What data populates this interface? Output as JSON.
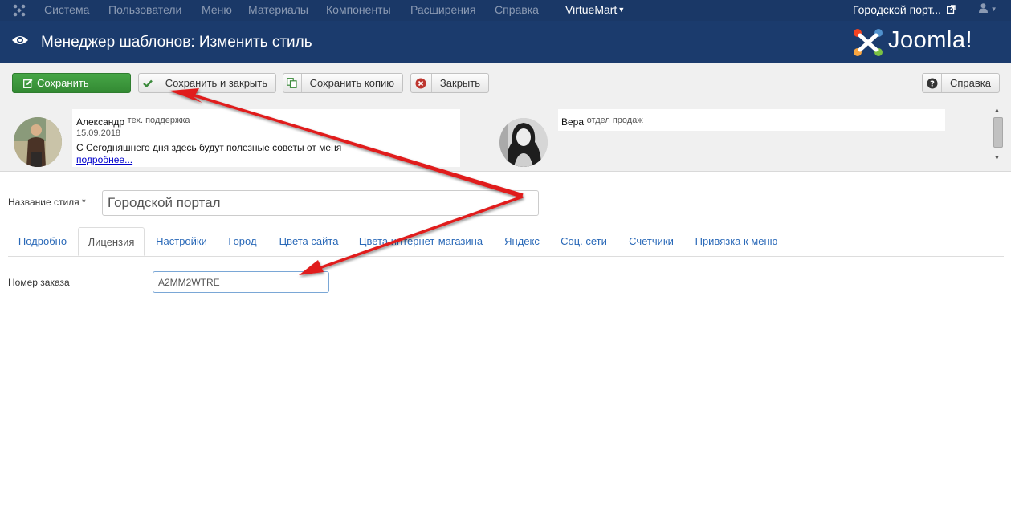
{
  "topnav": {
    "items": [
      "Система",
      "Пользователи",
      "Меню",
      "Материалы",
      "Компоненты",
      "Расширения",
      "Справка"
    ],
    "virtuemart": "VirtueMart",
    "site_link": "Городской порт..."
  },
  "header": {
    "title": "Менеджер шаблонов: Изменить стиль",
    "brand": "Joomla!"
  },
  "toolbar": {
    "save": "Сохранить",
    "save_close": "Сохранить и закрыть",
    "save_copy": "Сохранить копию",
    "close": "Закрыть",
    "help": "Справка"
  },
  "comments": [
    {
      "name": "Александр",
      "role": "тех. поддержка",
      "date": "15.09.2018",
      "text": "С Сегодняшнего дня здесь будут полезные советы от меня",
      "link": "подробнее..."
    },
    {
      "name": "Вера",
      "role": "отдел продаж"
    }
  ],
  "form": {
    "style_name_label": "Название стиля *",
    "style_name_value": "Городской портал",
    "order_label": "Номер заказа",
    "order_value": "A2MM2WTRE"
  },
  "tabs": [
    "Подробно",
    "Лицензия",
    "Настройки",
    "Город",
    "Цвета сайта",
    "Цвета интернет-магазина",
    "Яндекс",
    "Соц. сети",
    "Счетчики",
    "Привязка к меню"
  ],
  "active_tab": "Лицензия",
  "colors": {
    "topnav_bg": "#1a3867",
    "header_bg": "#1b3b6d",
    "save_green": "#46a546",
    "link_blue": "#2a69b8",
    "arrow_red": "#e01e1e"
  }
}
